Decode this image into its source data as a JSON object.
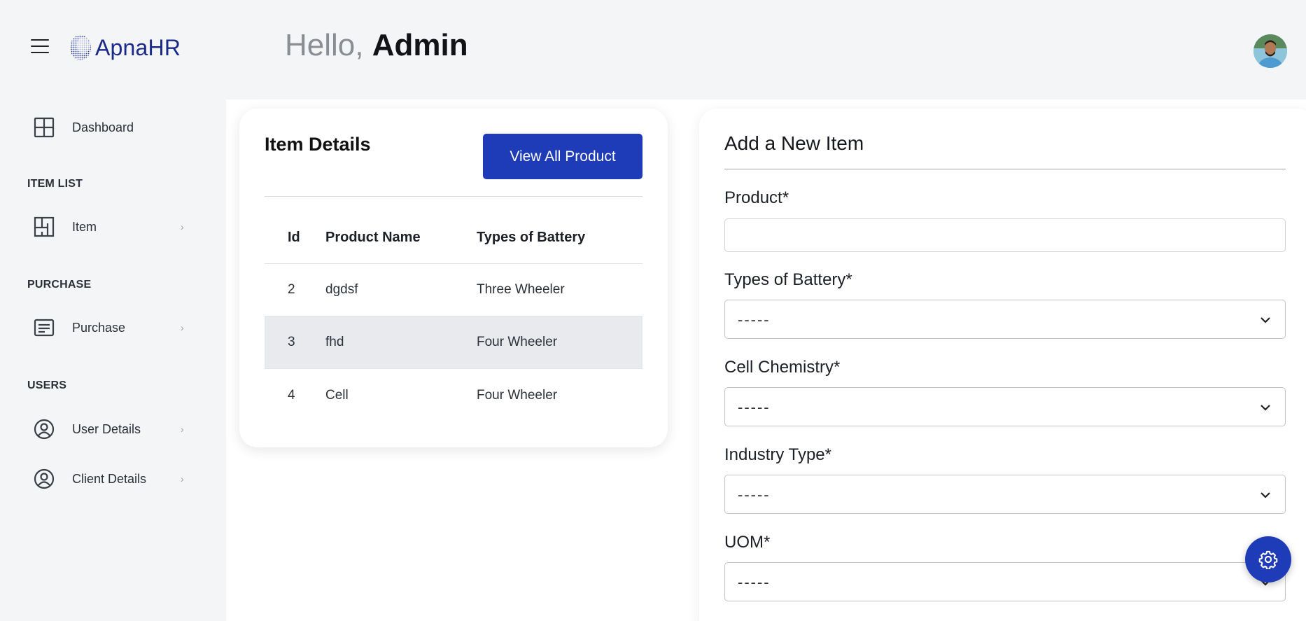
{
  "header": {
    "brand": "ApnaHR",
    "greeting_prefix": "Hello,",
    "greeting_name": "Admin"
  },
  "sidebar": {
    "dashboard": {
      "label": "Dashboard",
      "icon": "grid-icon"
    },
    "sections": [
      {
        "title": "ITEM LIST",
        "item": {
          "label": "Item",
          "icon": "layout-icon"
        }
      },
      {
        "title": "PURCHASE",
        "item": {
          "label": "Purchase",
          "icon": "document-icon"
        }
      },
      {
        "title": "USERS",
        "items": [
          {
            "label": "User Details",
            "icon": "user-circle-icon"
          },
          {
            "label": "Client Details",
            "icon": "user-circle-icon"
          }
        ]
      }
    ],
    "chevron": "›"
  },
  "item_details": {
    "title": "Item Details",
    "view_all_button": "View All Product",
    "columns": [
      "Id",
      "Product Name",
      "Types of Battery"
    ],
    "rows": [
      {
        "id": "2",
        "name": "dgdsf",
        "type": "Three Wheeler"
      },
      {
        "id": "3",
        "name": "fhd",
        "type": "Four Wheeler"
      },
      {
        "id": "4",
        "name": "Cell",
        "type": "Four Wheeler"
      }
    ]
  },
  "add_item_form": {
    "title": "Add a New Item",
    "product_label": "Product*",
    "product_value": "",
    "battery_label": "Types of Battery*",
    "battery_value": "-----",
    "chemistry_label": "Cell Chemistry*",
    "chemistry_value": "-----",
    "industry_label": "Industry Type*",
    "industry_value": "-----",
    "uom_label": "UOM*",
    "uom_value": "-----"
  },
  "colors": {
    "primary": "#1e3bb8",
    "brand_text": "#1b2a8a",
    "background": "#f4f5f7",
    "row_highlight": "#e9eaee"
  }
}
